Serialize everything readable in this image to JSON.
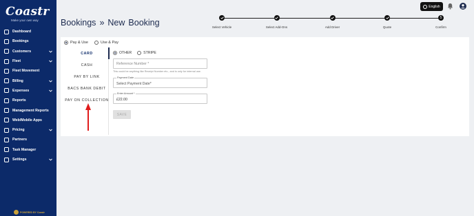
{
  "brand": {
    "name": "Coastr",
    "tagline": "Make your own way"
  },
  "sidebar": {
    "items": [
      {
        "label": "Dashboard",
        "icon": "dashboard-icon",
        "has_children": false
      },
      {
        "label": "Bookings",
        "icon": "bookings-icon",
        "has_children": false
      },
      {
        "label": "Customers",
        "icon": "customers-icon",
        "has_children": true
      },
      {
        "label": "Fleet",
        "icon": "fleet-icon",
        "has_children": true
      },
      {
        "label": "Fleet Movement",
        "icon": "fleet-movement-icon",
        "has_children": false
      },
      {
        "label": "Billing",
        "icon": "billing-icon",
        "has_children": true
      },
      {
        "label": "Expenses",
        "icon": "expenses-icon",
        "has_children": true
      },
      {
        "label": "Reports",
        "icon": "reports-icon",
        "has_children": false
      },
      {
        "label": "Management Reports",
        "icon": "management-reports-icon",
        "has_children": false
      },
      {
        "label": "Web/Mobile Apps",
        "icon": "web-mobile-icon",
        "has_children": false
      },
      {
        "label": "Pricing",
        "icon": "pricing-icon",
        "has_children": true
      },
      {
        "label": "Partners",
        "icon": "partners-icon",
        "has_children": false
      },
      {
        "label": "Task Manager",
        "icon": "task-manager-icon",
        "has_children": false
      },
      {
        "label": "Settings",
        "icon": "settings-icon",
        "has_children": true
      }
    ],
    "powered_by": "POWERED BY Coastr"
  },
  "header": {
    "breadcrumb": [
      "Bookings",
      "»",
      "New",
      "Booking"
    ],
    "language": "English",
    "steps": [
      {
        "label": "Select Vehicle",
        "state": "done"
      },
      {
        "label": "Select Add-Ons",
        "state": "done"
      },
      {
        "label": "Add Driver",
        "state": "done"
      },
      {
        "label": "Quote",
        "state": "done"
      },
      {
        "label": "Confirm",
        "state": "current",
        "number": "5"
      }
    ]
  },
  "payment": {
    "mode_options": [
      {
        "label": "Pay & Use",
        "selected": true
      },
      {
        "label": "Use & Pay",
        "selected": false
      }
    ],
    "tabs": [
      {
        "label": "CARD",
        "active": true
      },
      {
        "label": "CASH",
        "active": false
      },
      {
        "label": "PAY BY LINK",
        "active": false
      },
      {
        "label": "BACS BANK DEBIT",
        "active": false
      },
      {
        "label": "PAY ON COLLECTION",
        "active": false
      }
    ],
    "methods": [
      {
        "label": "OTHER",
        "selected": true
      },
      {
        "label": "STRIPE",
        "selected": false
      }
    ],
    "reference_placeholder": "Reference Number *",
    "reference_hint": "This could be anything like Receipt Number etc., and is only for internal use.",
    "payment_date_label": "Payment Date",
    "payment_date_placeholder": "Select Payment Date*",
    "amount_label": "Enter Amount *",
    "amount_value": "£22.00",
    "save_label": "SAVE"
  },
  "colors": {
    "sidebar_bg": "#0c2a69",
    "annotation_arrow": "#e01b1b",
    "accent": "#1d2b4f"
  }
}
